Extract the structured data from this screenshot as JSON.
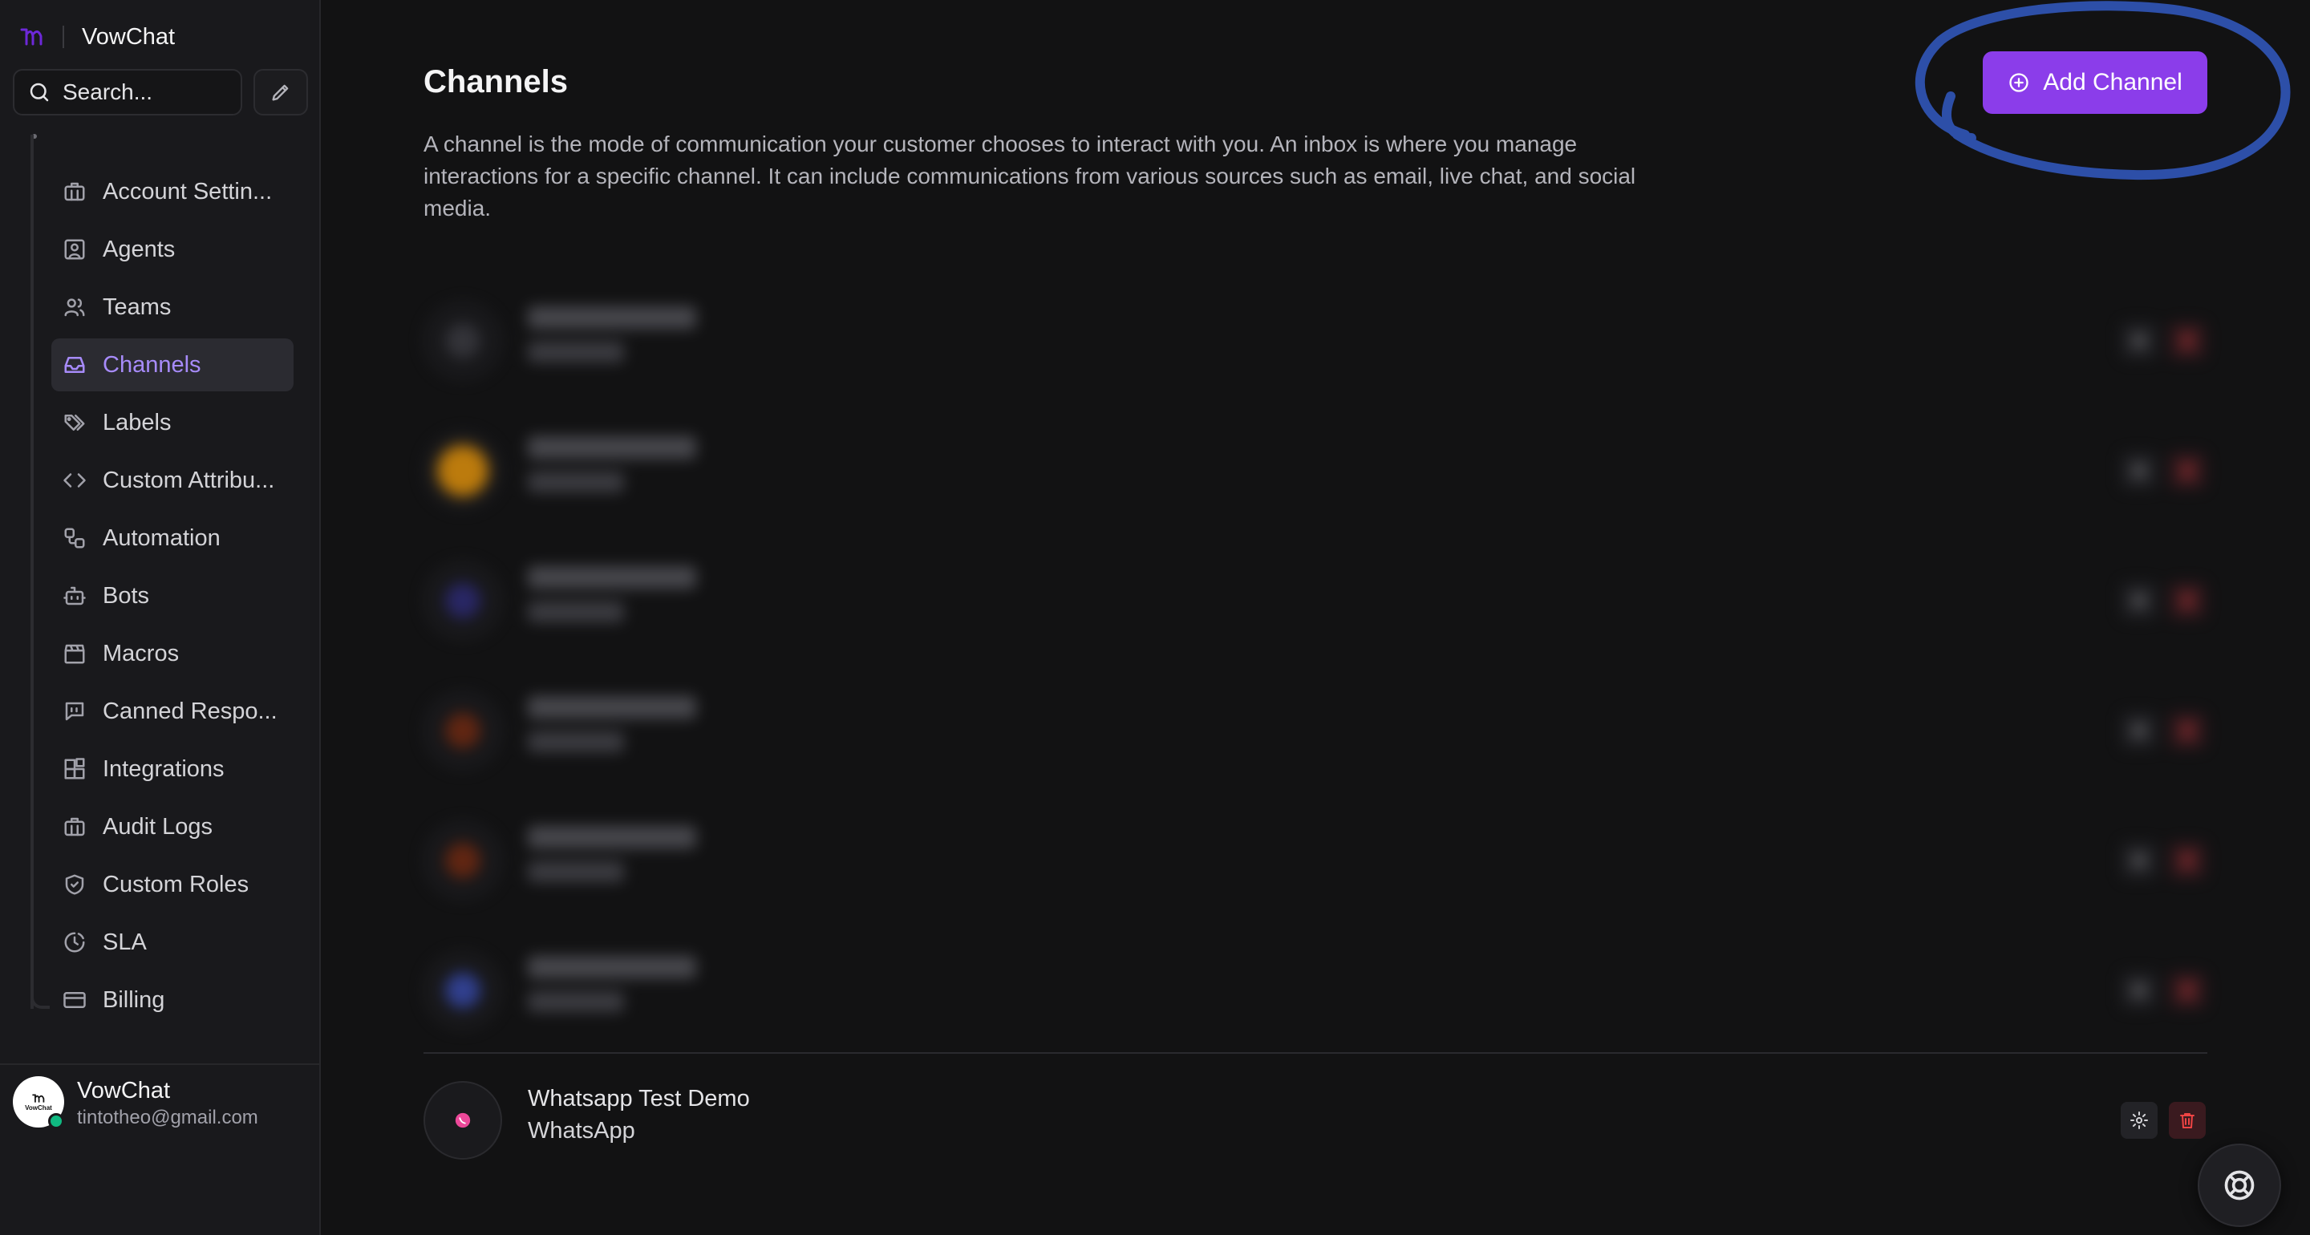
{
  "app": {
    "name": "VowChat"
  },
  "search": {
    "placeholder": "Search..."
  },
  "sidebar": {
    "items": [
      {
        "label": "Account Settin...",
        "icon": "briefcase-icon",
        "active": false
      },
      {
        "label": "Agents",
        "icon": "user-square-icon",
        "active": false
      },
      {
        "label": "Teams",
        "icon": "users-icon",
        "active": false
      },
      {
        "label": "Channels",
        "icon": "inbox-icon",
        "active": true
      },
      {
        "label": "Labels",
        "icon": "tags-icon",
        "active": false
      },
      {
        "label": "Custom Attribu...",
        "icon": "code-icon",
        "active": false
      },
      {
        "label": "Automation",
        "icon": "workflow-icon",
        "active": false
      },
      {
        "label": "Bots",
        "icon": "bot-icon",
        "active": false
      },
      {
        "label": "Macros",
        "icon": "clapperboard-icon",
        "active": false
      },
      {
        "label": "Canned Respo...",
        "icon": "message-quote-icon",
        "active": false
      },
      {
        "label": "Integrations",
        "icon": "blocks-icon",
        "active": false
      },
      {
        "label": "Audit Logs",
        "icon": "briefcase-icon",
        "active": false
      },
      {
        "label": "Custom Roles",
        "icon": "shield-icon",
        "active": false
      },
      {
        "label": "SLA",
        "icon": "clock-icon",
        "active": false
      },
      {
        "label": "Billing",
        "icon": "credit-card-icon",
        "active": false
      }
    ]
  },
  "profile": {
    "name": "VowChat",
    "email": "tintotheo@gmail.com",
    "avatar_text": "VowChat",
    "status": "online"
  },
  "main": {
    "title": "Channels",
    "description": "A channel is the mode of communication your customer chooses to interact with you. An inbox is where you manage interactions for a specific channel. It can include communications from various sources such as email, live chat, and social media.",
    "add_button_label": "Add Channel"
  },
  "channels": [
    {
      "name": "",
      "type": "",
      "blurred": true,
      "icon_color": "#3f3f46"
    },
    {
      "name": "",
      "type": "",
      "blurred": true,
      "icon_color": "#f59e0b"
    },
    {
      "name": "",
      "type": "",
      "blurred": true,
      "icon_color": "#312e81"
    },
    {
      "name": "",
      "type": "",
      "blurred": true,
      "icon_color": "#7c2d12"
    },
    {
      "name": "",
      "type": "",
      "blurred": true,
      "icon_color": "#7c2d12"
    },
    {
      "name": "",
      "type": "",
      "blurred": true,
      "icon_color": "#3b4fb8"
    },
    {
      "name": "Whatsapp Test Demo",
      "type": "WhatsApp",
      "blurred": false,
      "icon_color": "#ec4899"
    }
  ],
  "colors": {
    "accent": "#8b3dea",
    "active_nav_text": "#a78bfa",
    "annotation": "#2d4fa8",
    "delete": "#ef4444"
  }
}
